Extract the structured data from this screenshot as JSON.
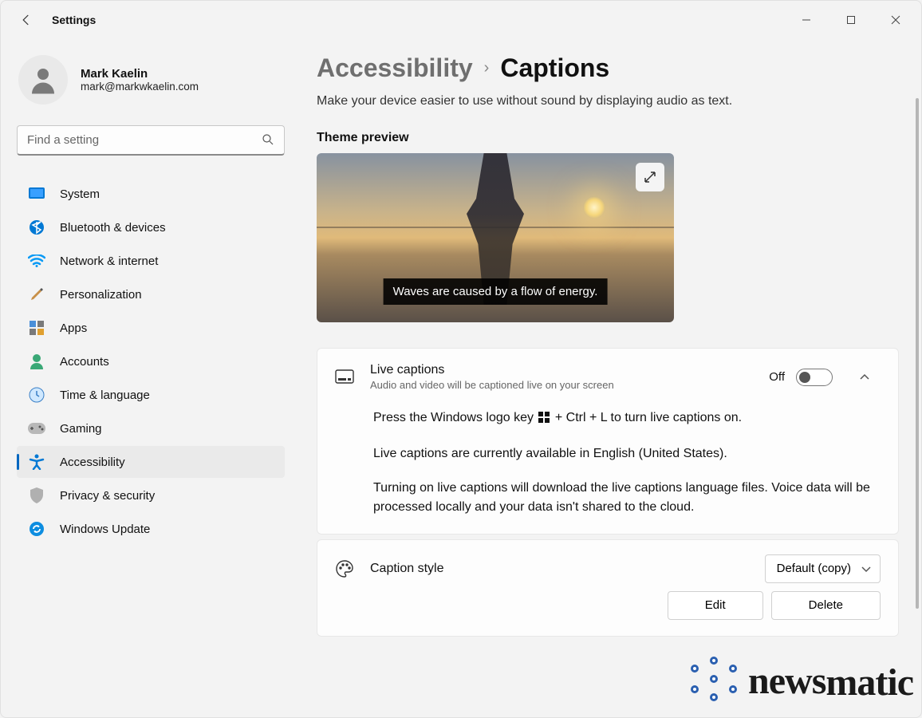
{
  "window": {
    "title": "Settings"
  },
  "profile": {
    "name": "Mark Kaelin",
    "email": "mark@markwkaelin.com"
  },
  "search": {
    "placeholder": "Find a setting"
  },
  "nav": {
    "items": [
      {
        "label": "System"
      },
      {
        "label": "Bluetooth & devices"
      },
      {
        "label": "Network & internet"
      },
      {
        "label": "Personalization"
      },
      {
        "label": "Apps"
      },
      {
        "label": "Accounts"
      },
      {
        "label": "Time & language"
      },
      {
        "label": "Gaming"
      },
      {
        "label": "Accessibility"
      },
      {
        "label": "Privacy & security"
      },
      {
        "label": "Windows Update"
      }
    ]
  },
  "breadcrumb": {
    "parent": "Accessibility",
    "current": "Captions"
  },
  "page": {
    "description": "Make your device easier to use without sound by displaying audio as text.",
    "preview_heading": "Theme preview",
    "caption_sample": "Waves are caused by a flow of energy."
  },
  "live_captions": {
    "title": "Live captions",
    "subtitle": "Audio and video will be captioned live on your screen",
    "state": "Off",
    "tip_prefix": "Press the Windows logo key ",
    "tip_suffix": " + Ctrl + L to turn live captions on.",
    "lang": "Live captions are currently available in English (United States).",
    "note": "Turning on live captions will download the live captions language files. Voice data will be processed locally and your data isn't shared to the cloud."
  },
  "caption_style": {
    "title": "Caption style",
    "selected": "Default (copy)",
    "edit": "Edit",
    "delete": "Delete"
  }
}
